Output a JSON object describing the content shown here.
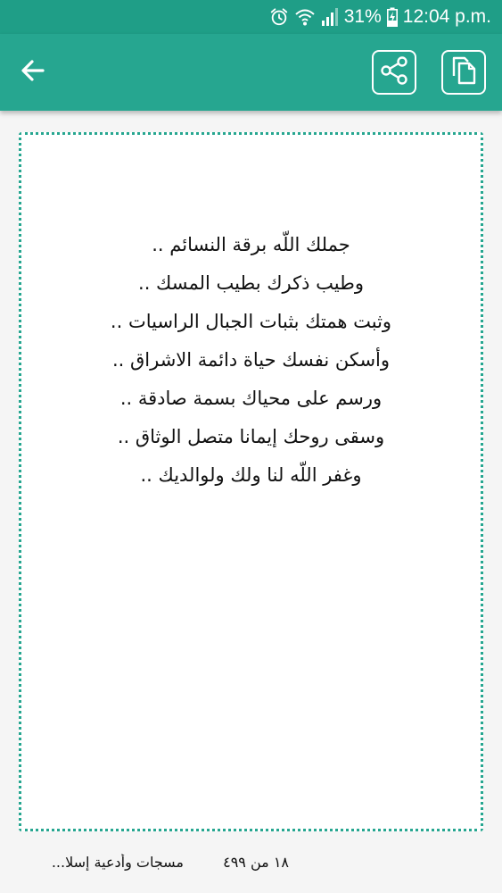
{
  "status_bar": {
    "battery_percent": "31%",
    "time": "12:04 p.m.",
    "icons": [
      "alarm-icon",
      "wifi-icon",
      "signal-icon",
      "battery-charging-icon"
    ]
  },
  "app_bar": {
    "icons": {
      "back": "arrow-back-icon",
      "share": "share-icon",
      "copy": "copy-icon"
    }
  },
  "message": {
    "lines": [
      "جملك اللّه برقة النسائم ..",
      "وطيب ذكرك بطيب المسك ..",
      "وثبت همتك بثبات الجبال الراسيات ..",
      "وأسكن نفسك حياة دائمة الاشراق ..",
      "ورسم على محياك بسمة صادقة ..",
      "وسقى روحك إيمانا متصل الوثاق ..",
      "وغفر اللّه لنا ولك ولوالديك .."
    ]
  },
  "footer": {
    "title": "مسجات وأدعية إسلا...",
    "counter": "١٨ من ٤٩٩"
  },
  "colors": {
    "primary": "#26a690",
    "status_bar": "#1f9e87",
    "text": "#111111",
    "card_border": "#26a690"
  }
}
